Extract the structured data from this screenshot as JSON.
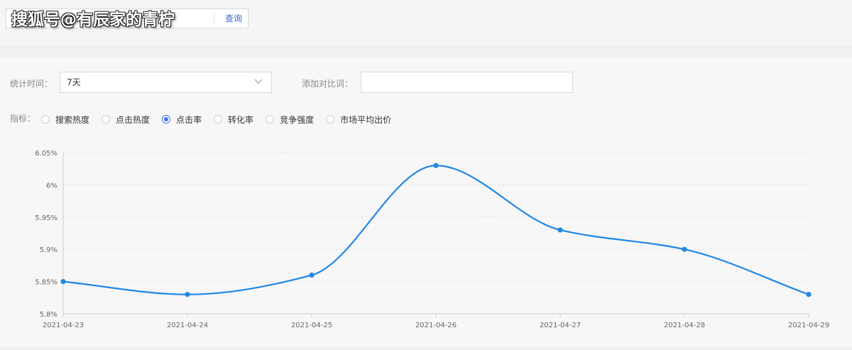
{
  "search": {
    "button_label": "查询",
    "watermark": "搜狐号@有辰家的青柠"
  },
  "filters": {
    "time_label": "统计时间：",
    "time_value": "7天",
    "compare_label": "添加对比词：",
    "compare_value": ""
  },
  "metrics": {
    "label": "指标：",
    "options": [
      {
        "label": "搜索热度",
        "selected": false
      },
      {
        "label": "点击热度",
        "selected": false
      },
      {
        "label": "点击率",
        "selected": true
      },
      {
        "label": "转化率",
        "selected": false
      },
      {
        "label": "竞争强度",
        "selected": false
      },
      {
        "label": "市场平均出价",
        "selected": false
      }
    ]
  },
  "chart_data": {
    "type": "line",
    "x": [
      "2021-04-23",
      "2021-04-24",
      "2021-04-25",
      "2021-04-26",
      "2021-04-27",
      "2021-04-28",
      "2021-04-29"
    ],
    "values": [
      5.85,
      5.83,
      5.86,
      6.03,
      5.93,
      5.9,
      5.83
    ],
    "y_ticks": [
      "5.8%",
      "5.85%",
      "5.9%",
      "5.95%",
      "6%",
      "6.05%"
    ],
    "ylim": [
      5.8,
      6.05
    ],
    "grid": true,
    "line_color": "#1e88e5",
    "title": "",
    "xlabel": "",
    "ylabel": ""
  }
}
